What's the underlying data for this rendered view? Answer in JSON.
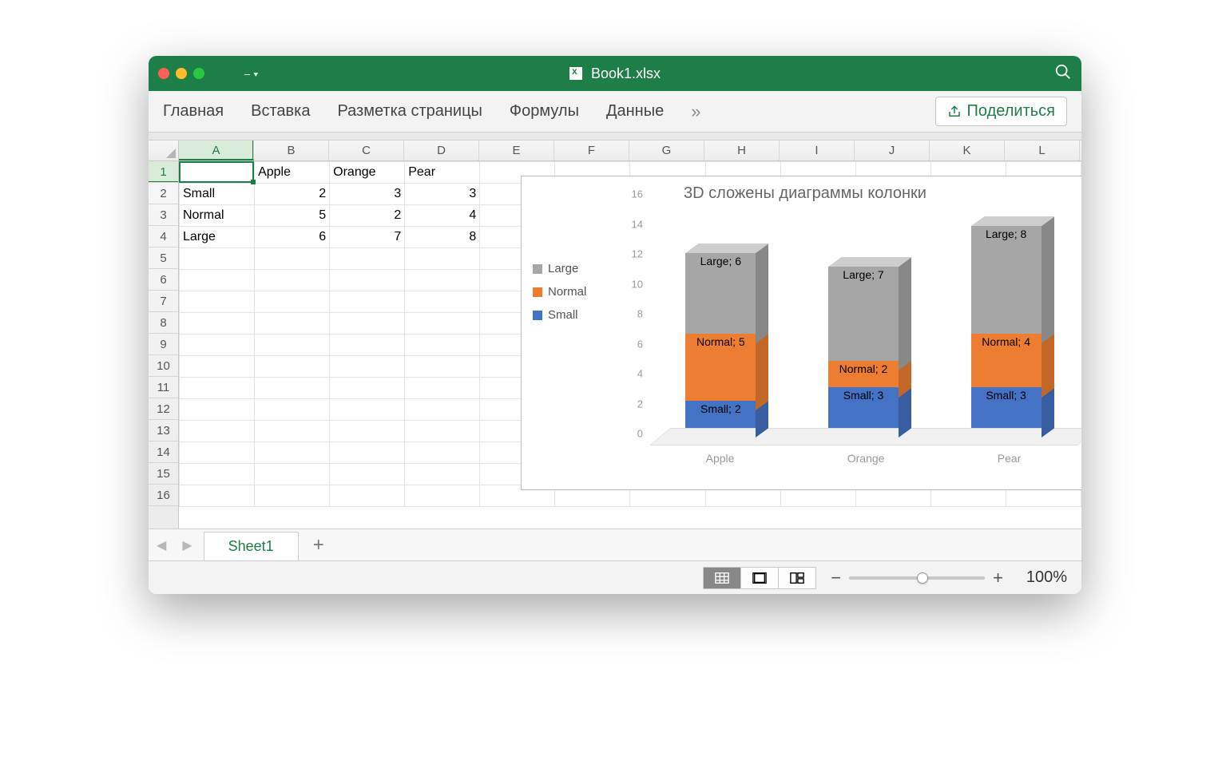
{
  "title": "Book1.xlsx",
  "ribbon": {
    "tabs": [
      "Главная",
      "Вставка",
      "Разметка страницы",
      "Формулы",
      "Данные"
    ],
    "share_label": "Поделиться"
  },
  "columns": [
    "A",
    "B",
    "C",
    "D",
    "E",
    "F",
    "G",
    "H",
    "I",
    "J",
    "K",
    "L"
  ],
  "rows_shown": 16,
  "selected_cell": "A1",
  "table": {
    "headers": [
      "",
      "Apple",
      "Orange",
      "Pear"
    ],
    "rows": [
      {
        "label": "Small",
        "values": [
          2,
          3,
          3
        ]
      },
      {
        "label": "Normal",
        "values": [
          5,
          2,
          4
        ]
      },
      {
        "label": "Large",
        "values": [
          6,
          7,
          8
        ]
      }
    ]
  },
  "chart_data": {
    "type": "bar",
    "stacked": true,
    "is_3d": true,
    "title": "3D сложены диаграммы колонки",
    "categories": [
      "Apple",
      "Orange",
      "Pear"
    ],
    "series": [
      {
        "name": "Small",
        "values": [
          2,
          3,
          3
        ],
        "color": "#4472c4"
      },
      {
        "name": "Normal",
        "values": [
          5,
          2,
          4
        ],
        "color": "#ed7d31"
      },
      {
        "name": "Large",
        "values": [
          6,
          7,
          8
        ],
        "color": "#a6a6a6"
      }
    ],
    "yticks": [
      0,
      2,
      4,
      6,
      8,
      10,
      12,
      14,
      16
    ],
    "ylim": [
      0,
      16
    ],
    "legend_position": "left",
    "data_labels": [
      [
        "Small; 2",
        "Small; 3",
        "Small; 3"
      ],
      [
        "Normal; 5",
        "Normal; 2",
        "Normal; 4"
      ],
      [
        "Large; 6",
        "Large; 7",
        "Large; 8"
      ]
    ]
  },
  "sheet_tabs": {
    "active": "Sheet1"
  },
  "status": {
    "zoom": "100%"
  }
}
